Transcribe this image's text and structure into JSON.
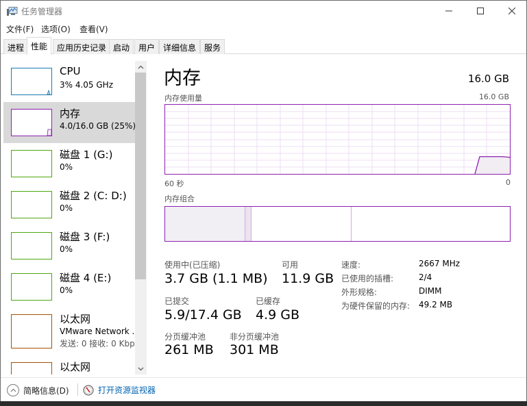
{
  "window": {
    "title": "任务管理器",
    "controls": {
      "minimize": "minimize",
      "maximize": "maximize",
      "close": "close"
    }
  },
  "menu": [
    "文件(F)",
    "选项(O)",
    "查看(V)"
  ],
  "tabs": [
    {
      "label": "进程",
      "active": false
    },
    {
      "label": "性能",
      "active": true
    },
    {
      "label": "应用历史记录",
      "active": false
    },
    {
      "label": "启动",
      "active": false
    },
    {
      "label": "用户",
      "active": false
    },
    {
      "label": "详细信息",
      "active": false
    },
    {
      "label": "服务",
      "active": false
    }
  ],
  "sidebar": {
    "items": [
      {
        "name": "CPU",
        "sub": "3% 4.05 GHz",
        "color": "#1879b2",
        "selected": false
      },
      {
        "name": "内存",
        "sub": "4.0/16.0 GB (25%)",
        "color": "#8b1faf",
        "selected": true
      },
      {
        "name": "磁盘 1 (G:)",
        "sub": "0%",
        "color": "#4da60c",
        "selected": false
      },
      {
        "name": "磁盘 2 (C: D:)",
        "sub": "0%",
        "color": "#4da60c",
        "selected": false
      },
      {
        "name": "磁盘 3 (F:)",
        "sub": "0%",
        "color": "#4da60c",
        "selected": false
      },
      {
        "name": "磁盘 4 (E:)",
        "sub": "0%",
        "color": "#4da60c",
        "selected": false
      },
      {
        "name": "以太网",
        "sub": "VMware Network .",
        "sub2": "发送: 0 接收: 0 Kbp",
        "color": "#a74f01",
        "selected": false
      },
      {
        "name": "以太网",
        "sub": "",
        "color": "#a74f01",
        "selected": false
      }
    ]
  },
  "main": {
    "title": "内存",
    "total": "16.0 GB",
    "usage_label": "内存使用量",
    "usage_max": "16.0 GB",
    "time_left": "60 秒",
    "time_right": "0",
    "composition_label": "内存组合",
    "accent": "#8b1faf",
    "usage_graph_recent_fraction": 0.25,
    "composition": {
      "in_use_fraction": 0.23,
      "modified_fraction": 0.02,
      "standby_fraction": 0.29,
      "free_fraction": 0.46
    },
    "stats": {
      "in_use_label": "使用中(已压缩)",
      "in_use_value": "3.7 GB (1.1 MB)",
      "available_label": "可用",
      "available_value": "11.9 GB",
      "committed_label": "已提交",
      "committed_value": "5.9/17.4 GB",
      "cached_label": "已缓存",
      "cached_value": "4.9 GB",
      "paged_label": "分页缓冲池",
      "paged_value": "261 MB",
      "nonpaged_label": "非分页缓冲池",
      "nonpaged_value": "301 MB"
    },
    "details": [
      {
        "label": "速度:",
        "value": "2667 MHz"
      },
      {
        "label": "已使用的插槽:",
        "value": "2/4"
      },
      {
        "label": "外形规格:",
        "value": "DIMM"
      },
      {
        "label": "为硬件保留的内存:",
        "value": "49.2 MB"
      }
    ]
  },
  "footer": {
    "fewer_details": "简略信息(D)",
    "open_resmon": "打开资源监视器"
  }
}
